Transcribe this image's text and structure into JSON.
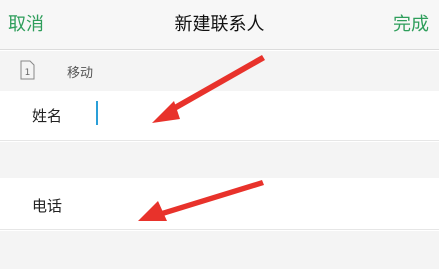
{
  "nav": {
    "cancel_label": "取消",
    "title": "新建联系人",
    "done_label": "完成",
    "accent_color": "#2e9e5b"
  },
  "account": {
    "icon": "sim-card-icon",
    "sim_number": "1",
    "label": "移动"
  },
  "fields": {
    "name_label": "姓名",
    "phone_label": "电话"
  },
  "annotations": {
    "arrow_color": "#e8322b",
    "arrow_count": 2
  }
}
